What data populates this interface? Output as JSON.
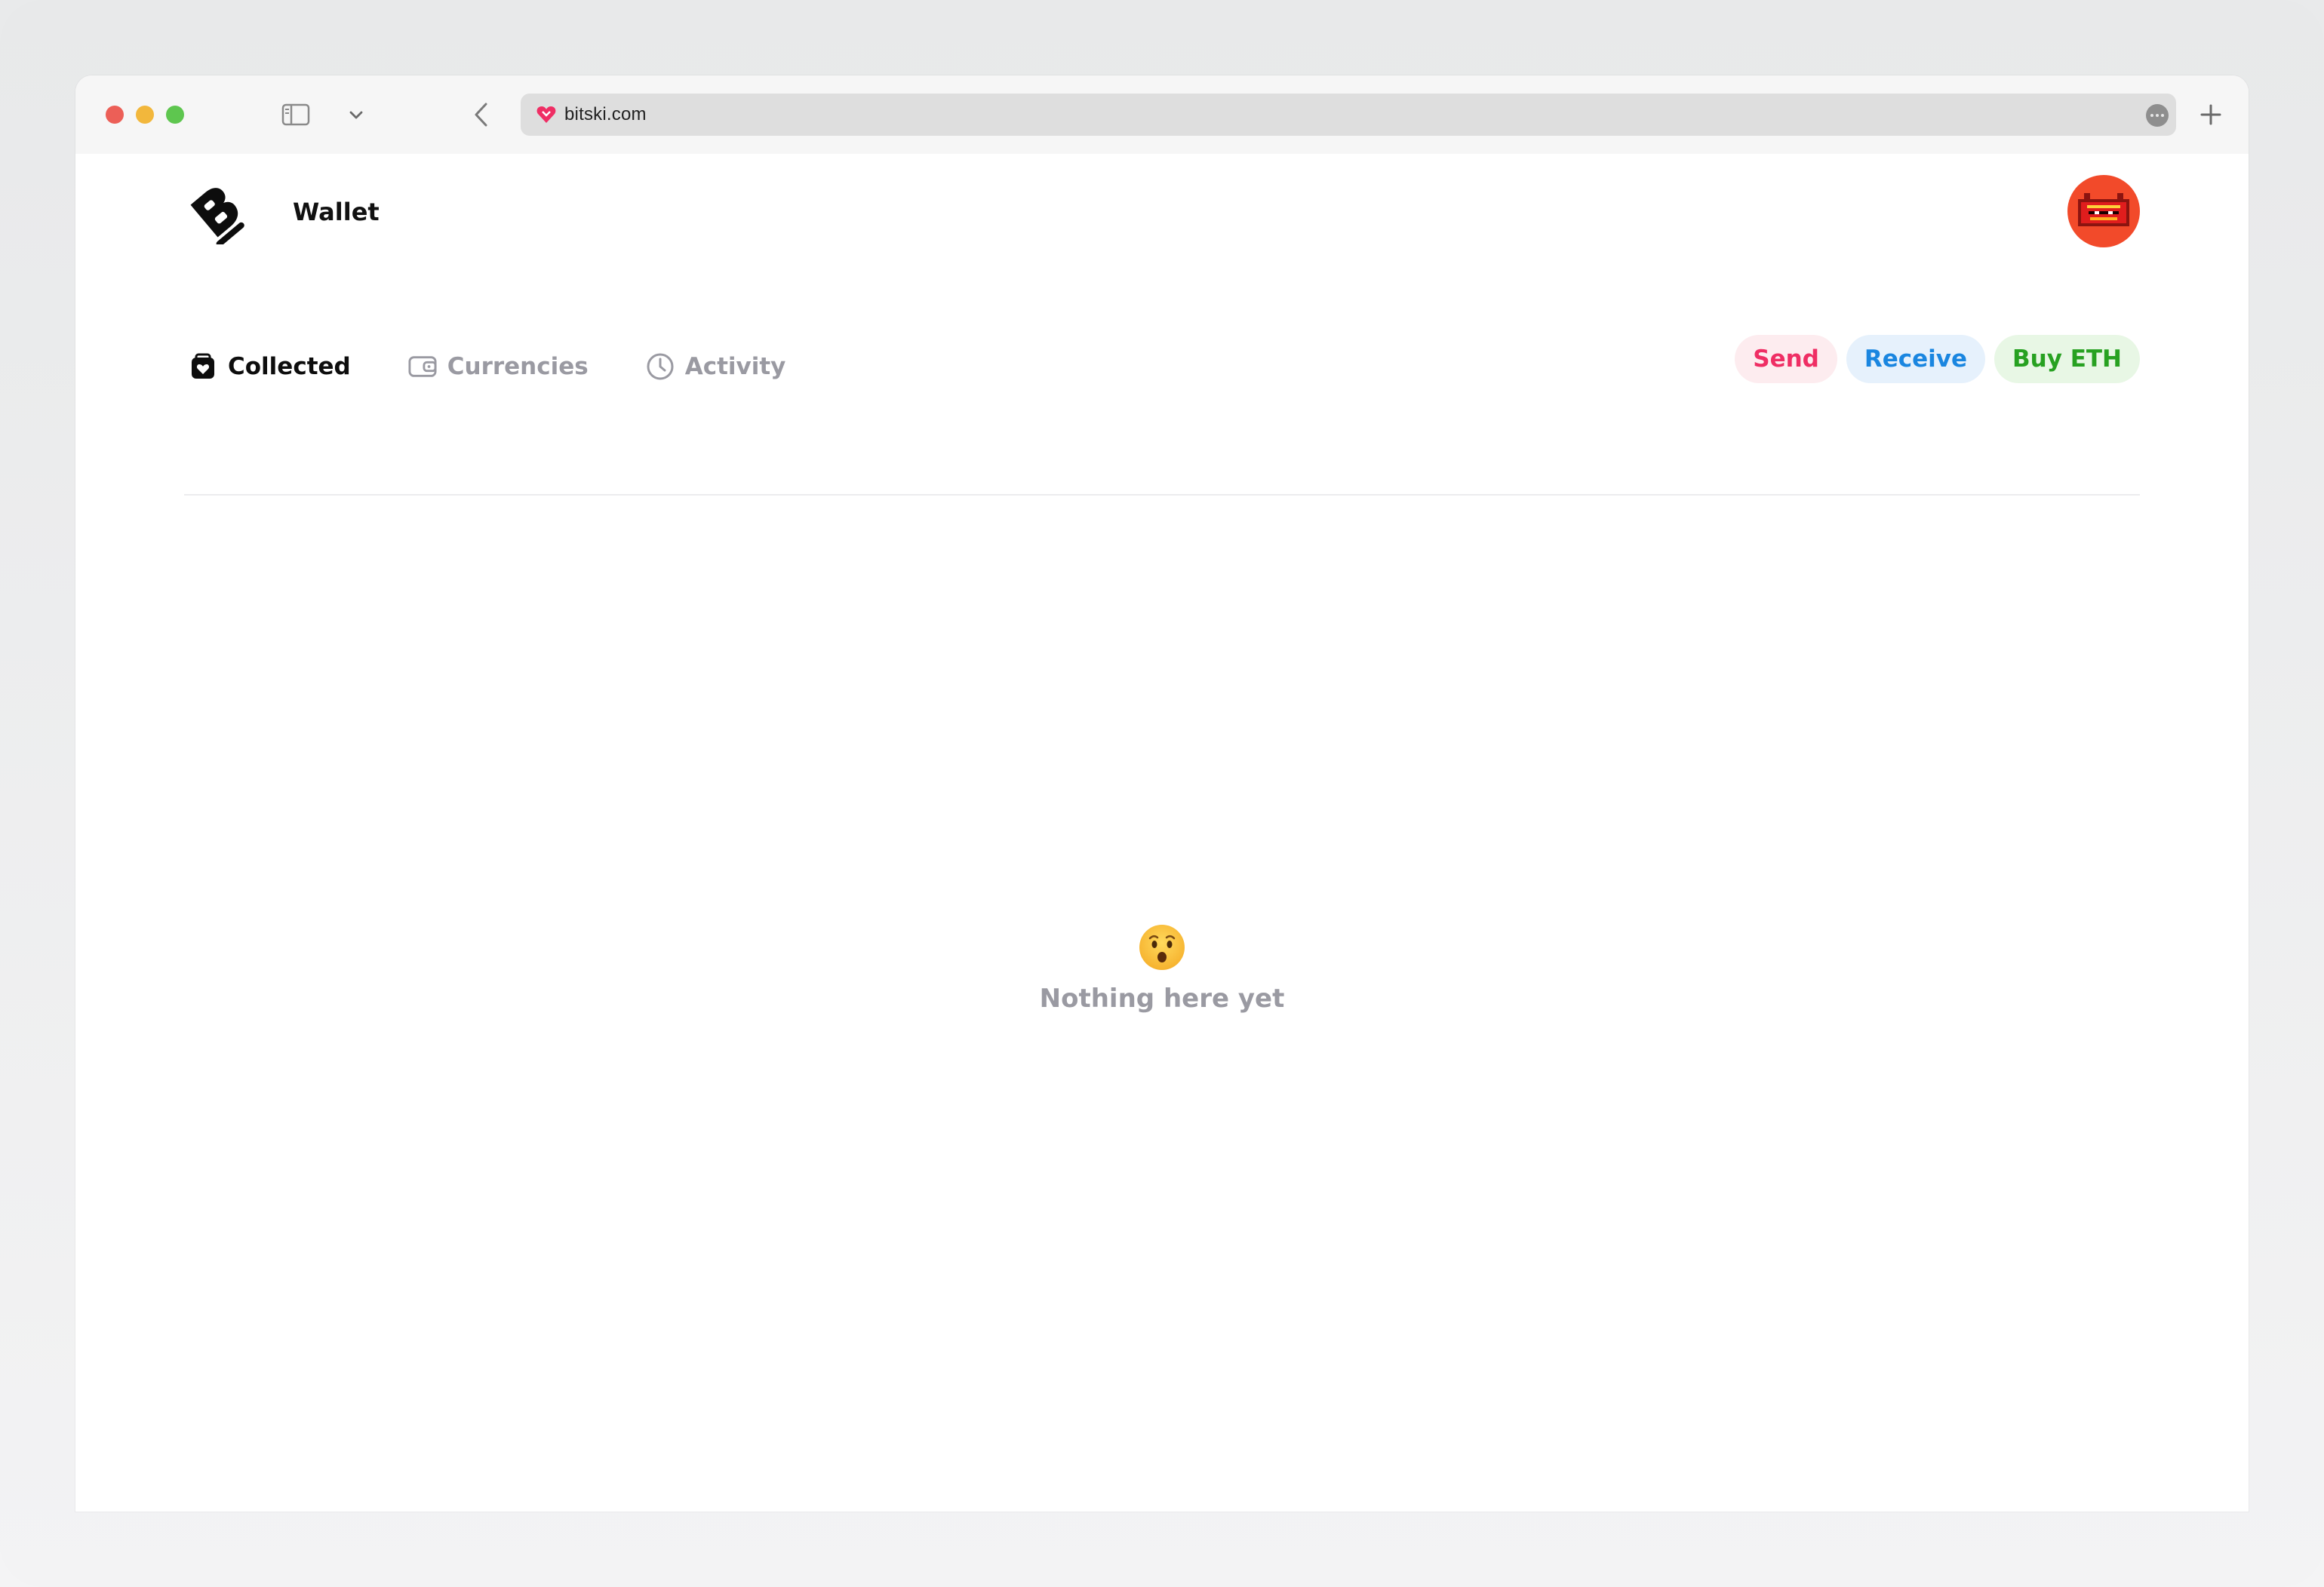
{
  "browser": {
    "url": "bitski.com",
    "favicon": "bitski-heart-icon",
    "traffic_lights": {
      "close": "#ec5f57",
      "minimize": "#f2b73c",
      "zoom": "#5ec64f"
    }
  },
  "header": {
    "title": "Wallet",
    "logo": "bitski-b-logo",
    "avatar": "red-pixel-creature-avatar"
  },
  "tabs": [
    {
      "label": "Collected",
      "icon": "bag-heart-icon",
      "active": true
    },
    {
      "label": "Currencies",
      "icon": "wallet-icon",
      "active": false
    },
    {
      "label": "Activity",
      "icon": "clock-icon",
      "active": false
    }
  ],
  "actions": {
    "send": "Send",
    "receive": "Receive",
    "buy": "Buy ETH"
  },
  "empty_state": {
    "emoji": "😯",
    "text": "Nothing here yet"
  },
  "colors": {
    "send": "#ef2e64",
    "receive": "#1a86e0",
    "buy": "#27a121",
    "inactive_tab": "#9a9aa2"
  }
}
